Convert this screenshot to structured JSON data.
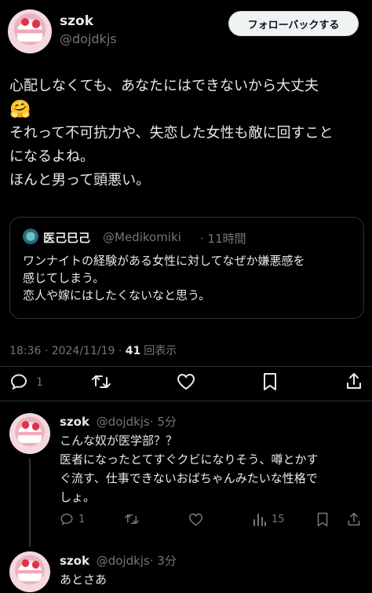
{
  "main_post": {
    "display_name": "szok",
    "handle": "@dojdkjs",
    "follow_label": "フォローバックする",
    "lines": [
      "心配しなくても、あなたにはできないから大丈夫",
      "それって不可抗力や、失恋した女性も敵に回すこと",
      "になるよね。",
      "ほんと男って頭悪い。"
    ],
    "emoji": "🤗",
    "timestamp": "18:36 · 2024/11/19 · ",
    "views_count": "41",
    "views_label": "回表示",
    "reply_count": "1"
  },
  "quote": {
    "display_name": "医己巳己",
    "handle": "@Medikomiki",
    "time": "· 11時間",
    "lines": [
      "ワンナイトの経験がある女性に対してなぜか嫌悪感を",
      "感じてしまう。",
      "恋人や嫁にはしたくないなと思う。"
    ]
  },
  "replies": [
    {
      "display_name": "szok",
      "handle": "@dojdkjs",
      "time": "· 5分",
      "lines": [
        "こんな奴が医学部？？",
        "医者になったとてすぐクビになりそう、噂とかす",
        "ぐ流す、仕事できないおばちゃんみたいな性格で",
        "しょ。"
      ],
      "reply_count": "1",
      "views_count": "15"
    },
    {
      "display_name": "szok",
      "handle": "@dojdkjs",
      "time": "· 3分",
      "lines": [
        "あとさあ"
      ]
    }
  ],
  "icons": [
    "reply-icon",
    "retweet-icon",
    "like-icon",
    "bookmark-icon",
    "share-icon",
    "views-icon",
    "verified-avatar-icon"
  ]
}
